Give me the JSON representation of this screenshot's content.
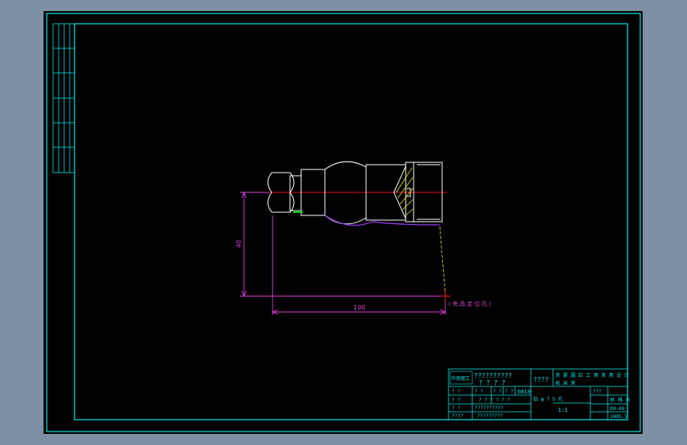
{
  "colors": {
    "background": "#7d8fa3",
    "paper": "#000000",
    "frame": "#00e8e8",
    "dimension": "#e040e0",
    "centerline": "#e01010",
    "part_outline": "#ffffff",
    "hatch": "#e8e800",
    "arc": "#a040ff",
    "note": "#e040e0"
  },
  "drawing": {
    "dim_vertical": "40",
    "dim_horizontal": "100",
    "note": "( 夹 具 定 位 孔 )"
  },
  "title_block": {
    "company": "??????????",
    "company_sub": "? ? ? ?",
    "col_title": "????",
    "project_line1": "夹 紧 圆 缸 工 具 夹 具 设 计",
    "project_line2": "机 床 夹",
    "row1": [
      "? ?",
      "? ?",
      "? ?",
      "? ?",
      "? ?",
      "0810"
    ],
    "row2": [
      "? ?",
      "? ?",
      "? ? ? ? ? ?"
    ],
    "row3": [
      "? ?",
      "? ?",
      "??????????"
    ],
    "row4": [
      "????",
      "? ?",
      "?????????"
    ],
    "mid_label": "钻 φ 7 5 孔",
    "scale_label": "1:1",
    "material": "???",
    "code": "D0-09",
    "school": "机 械 系",
    "sheet": "2005.5",
    "logo": "华南理工"
  }
}
